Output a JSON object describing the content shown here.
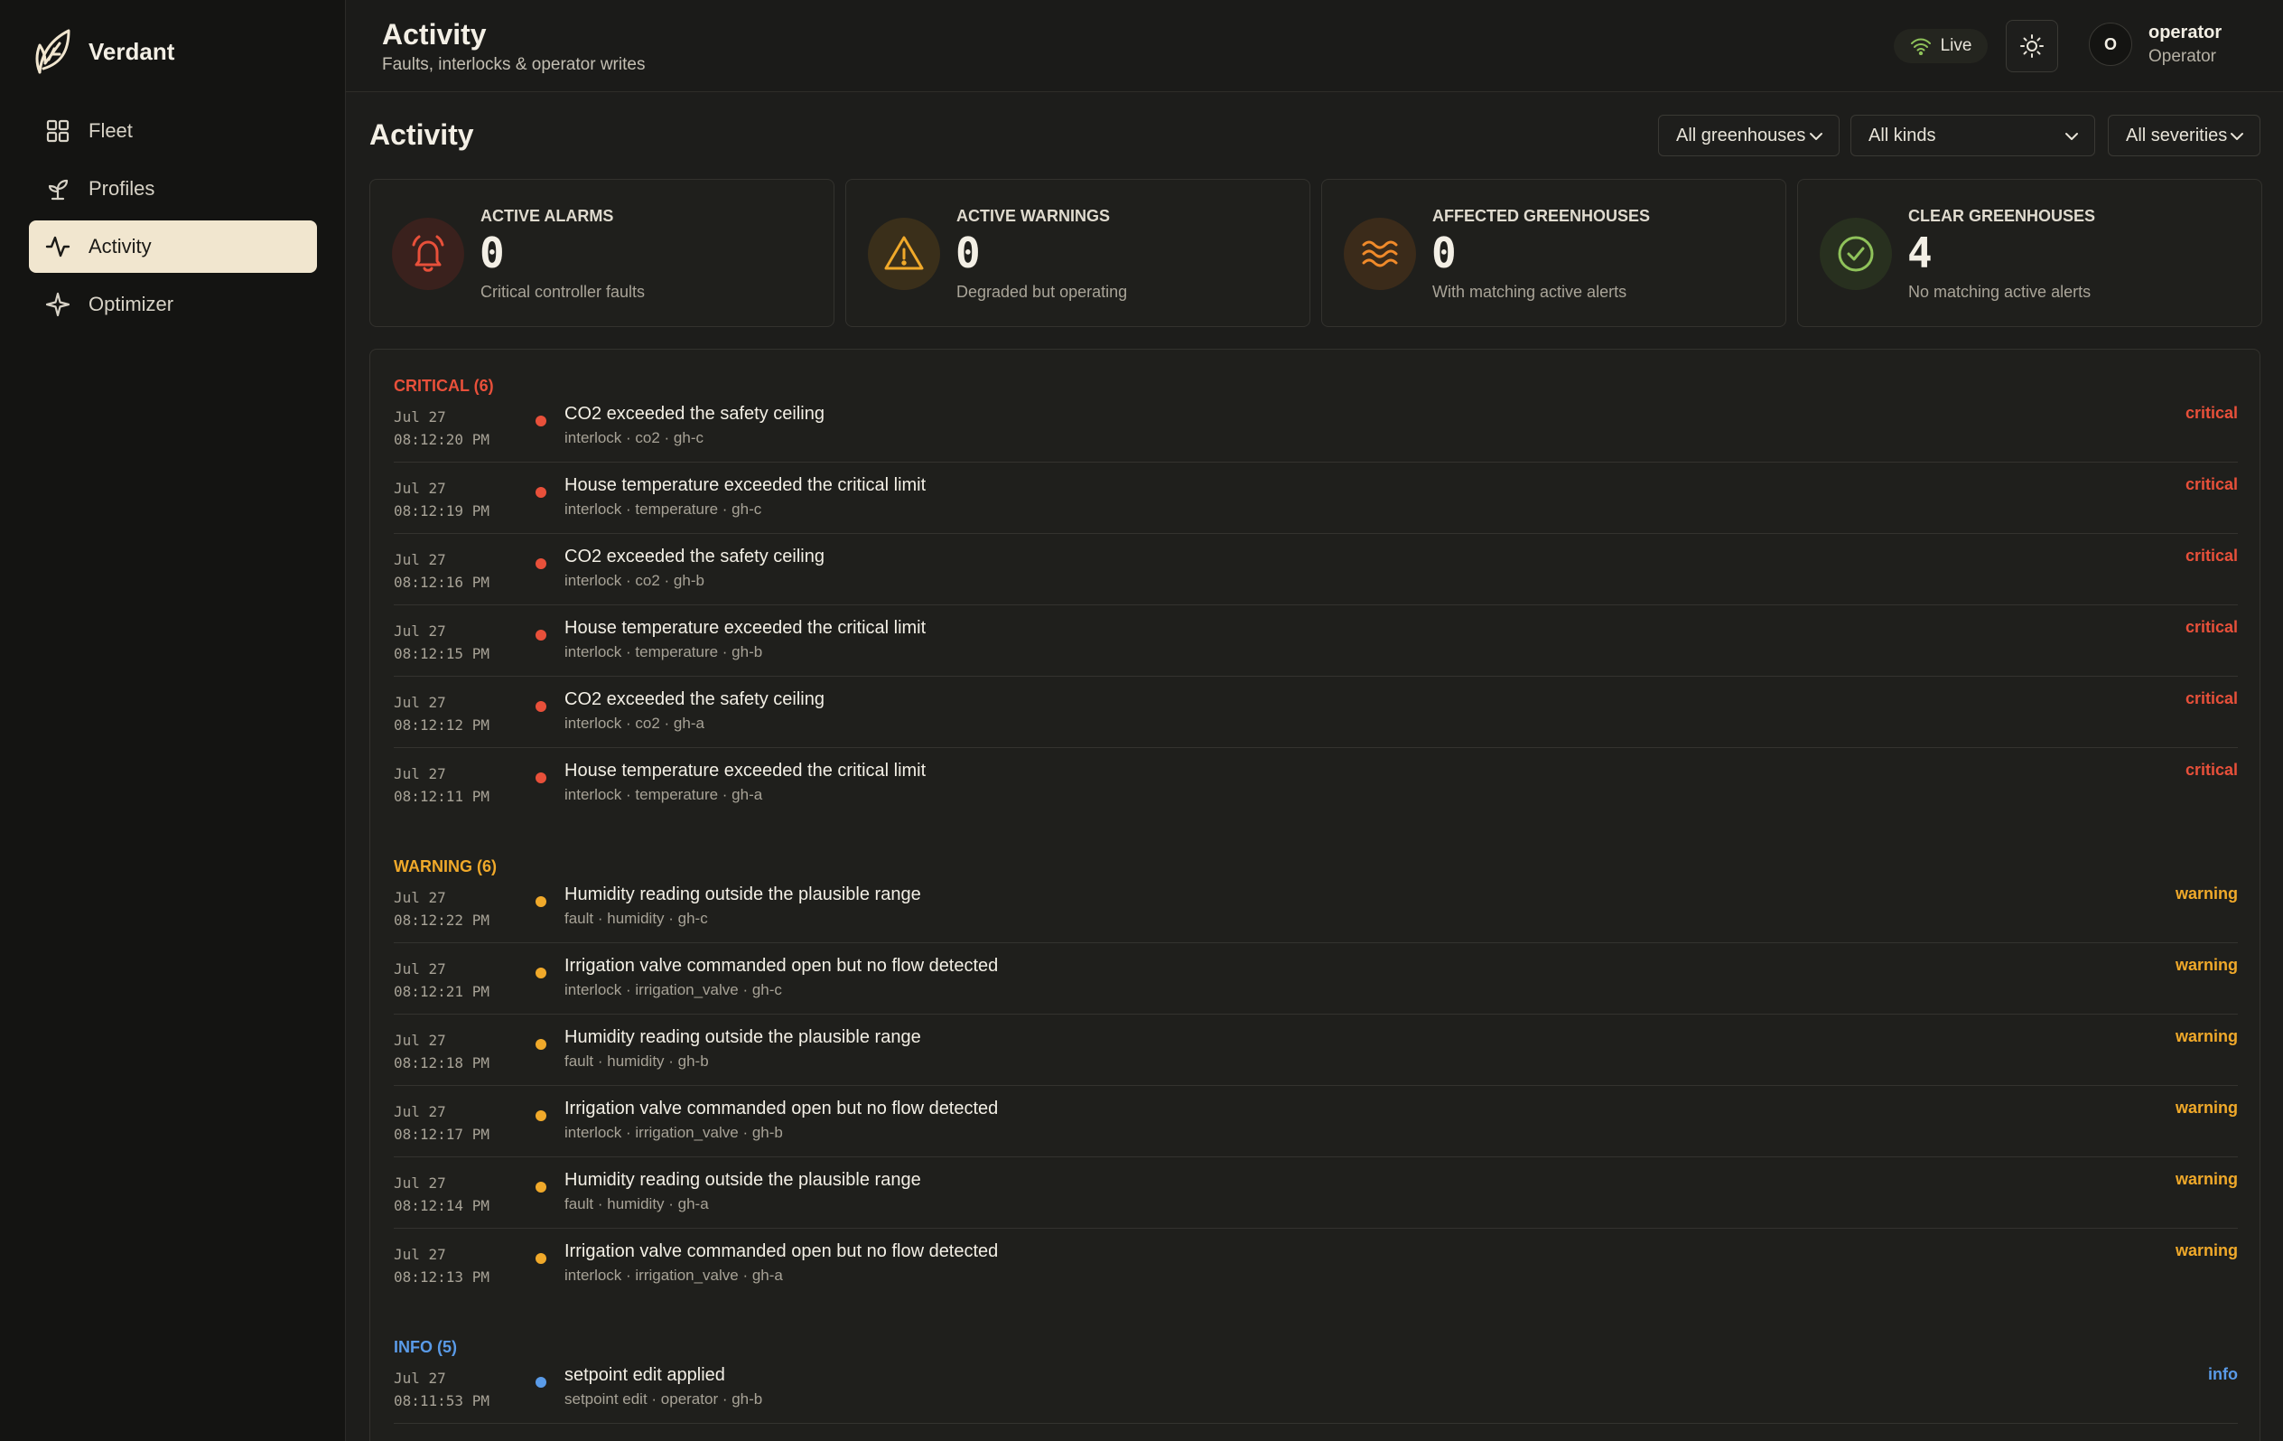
{
  "app": {
    "name": "Verdant"
  },
  "sidebar": {
    "items": [
      {
        "label": "Fleet",
        "icon": "grid-icon"
      },
      {
        "label": "Profiles",
        "icon": "sprout-icon"
      },
      {
        "label": "Activity",
        "icon": "activity-icon",
        "active": true
      },
      {
        "label": "Optimizer",
        "icon": "sparkle-icon"
      }
    ]
  },
  "header": {
    "title": "Activity",
    "subtitle": "Faults, interlocks & operator writes",
    "live_label": "Live",
    "user": {
      "initial": "O",
      "name": "operator",
      "role": "Operator"
    }
  },
  "main": {
    "title": "Activity",
    "filters": {
      "greenhouse": "All greenhouses",
      "kind": "All kinds",
      "severity": "All severities"
    },
    "stats": [
      {
        "label": "ACTIVE ALARMS",
        "value": "0",
        "desc": "Critical controller faults",
        "icon": "bell-icon"
      },
      {
        "label": "ACTIVE WARNINGS",
        "value": "0",
        "desc": "Degraded but operating",
        "icon": "warning-triangle-icon"
      },
      {
        "label": "AFFECTED GREENHOUSES",
        "value": "0",
        "desc": "With matching active alerts",
        "icon": "waves-icon"
      },
      {
        "label": "CLEAR GREENHOUSES",
        "value": "4",
        "desc": "No matching active alerts",
        "icon": "check-circle-icon"
      }
    ],
    "groups": [
      {
        "heading": "CRITICAL (6)",
        "color": "#e8503a",
        "events": [
          {
            "date": "Jul 27",
            "time": "08:12:20 PM",
            "title": "CO2 exceeded the safety ceiling",
            "meta": "interlock · co2 · gh-c",
            "severity": "critical"
          },
          {
            "date": "Jul 27",
            "time": "08:12:19 PM",
            "title": "House temperature exceeded the critical limit",
            "meta": "interlock · temperature · gh-c",
            "severity": "critical"
          },
          {
            "date": "Jul 27",
            "time": "08:12:16 PM",
            "title": "CO2 exceeded the safety ceiling",
            "meta": "interlock · co2 · gh-b",
            "severity": "critical"
          },
          {
            "date": "Jul 27",
            "time": "08:12:15 PM",
            "title": "House temperature exceeded the critical limit",
            "meta": "interlock · temperature · gh-b",
            "severity": "critical"
          },
          {
            "date": "Jul 27",
            "time": "08:12:12 PM",
            "title": "CO2 exceeded the safety ceiling",
            "meta": "interlock · co2 · gh-a",
            "severity": "critical"
          },
          {
            "date": "Jul 27",
            "time": "08:12:11 PM",
            "title": "House temperature exceeded the critical limit",
            "meta": "interlock · temperature · gh-a",
            "severity": "critical"
          }
        ]
      },
      {
        "heading": "WARNING (6)",
        "color": "#f0a92a",
        "events": [
          {
            "date": "Jul 27",
            "time": "08:12:22 PM",
            "title": "Humidity reading outside the plausible range",
            "meta": "fault · humidity · gh-c",
            "severity": "warning"
          },
          {
            "date": "Jul 27",
            "time": "08:12:21 PM",
            "title": "Irrigation valve commanded open but no flow detected",
            "meta": "interlock · irrigation_valve · gh-c",
            "severity": "warning"
          },
          {
            "date": "Jul 27",
            "time": "08:12:18 PM",
            "title": "Humidity reading outside the plausible range",
            "meta": "fault · humidity · gh-b",
            "severity": "warning"
          },
          {
            "date": "Jul 27",
            "time": "08:12:17 PM",
            "title": "Irrigation valve commanded open but no flow detected",
            "meta": "interlock · irrigation_valve · gh-b",
            "severity": "warning"
          },
          {
            "date": "Jul 27",
            "time": "08:12:14 PM",
            "title": "Humidity reading outside the plausible range",
            "meta": "fault · humidity · gh-a",
            "severity": "warning"
          },
          {
            "date": "Jul 27",
            "time": "08:12:13 PM",
            "title": "Irrigation valve commanded open but no flow detected",
            "meta": "interlock · irrigation_valve · gh-a",
            "severity": "warning"
          }
        ]
      },
      {
        "heading": "INFO (5)",
        "color": "#5a9be8",
        "events": [
          {
            "date": "Jul 27",
            "time": "08:11:53 PM",
            "title": "setpoint edit applied",
            "meta": "setpoint edit · operator · gh-b",
            "severity": "info"
          }
        ]
      }
    ]
  },
  "colors": {
    "critical": "#e8503a",
    "warning": "#f0a92a",
    "info": "#5a9be8",
    "clear": "#8fc25a",
    "accent": "#f1e6cf"
  }
}
